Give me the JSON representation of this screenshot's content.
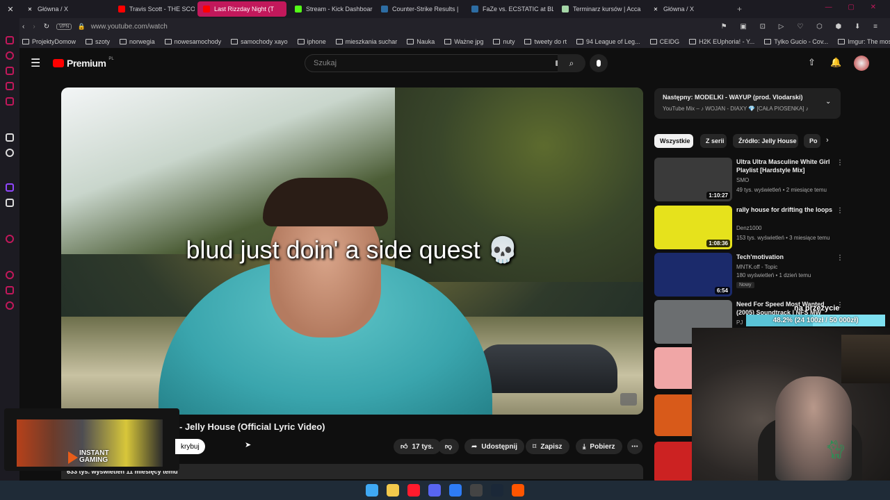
{
  "tabs": [
    {
      "label": "Główna / X",
      "icon": "x-logo-icon",
      "color": "#1c1b22"
    },
    {
      "label": "Travis Scott - THE SCOT",
      "icon": "youtube-icon",
      "color": "#ff0000"
    },
    {
      "label": "Last Rizzday Night (T",
      "icon": "youtube-icon",
      "color": "#ff0000",
      "active": true
    },
    {
      "label": "Stream - Kick Dashboard",
      "icon": "kick-icon",
      "color": "#53fc18"
    },
    {
      "label": "Counter-Strike Results | ",
      "icon": "hltv-icon",
      "color": "#2d6da3"
    },
    {
      "label": "FaZe vs. ECSTATIC at BL",
      "icon": "hltv-icon",
      "color": "#2d6da3"
    },
    {
      "label": "Terminarz kursów | Acca",
      "icon": "calendar-icon",
      "color": "#a5d6a7"
    },
    {
      "label": "Główna / X",
      "icon": "x-logo-icon",
      "color": "#1c1b22"
    }
  ],
  "address": {
    "vpn": "VPN",
    "url": "www.youtube.com/watch"
  },
  "bookmarks": [
    "ProjektyDomow",
    "szoty",
    "norwegia",
    "nowesamochody",
    "samochody xayo",
    "iphone",
    "mieszkania suchar",
    "Nauka",
    "Ważne jpg",
    "nuty",
    "tweety do rt",
    "94 League of Leg...",
    "CEIDG",
    "H2K EUphoria! - Y...",
    "Tylko Gucio - Cov...",
    "Imgur: The most a..."
  ],
  "yt": {
    "logo": "Premium",
    "logo_badge": "PL",
    "search_placeholder": "Szukaj",
    "caption": "blud just doin' a side quest 💀",
    "title": "- Jelly House (Official Lyric Video)",
    "hide_label": "krybuj",
    "likes": "17 tys.",
    "share": "Udostępnij",
    "save": "Zapisz",
    "download": "Pobierz",
    "views": "633 tys. wyświetleń  11 miesięcy temu",
    "ad_text_1": "INSTANT",
    "ad_text_2": "GAMING"
  },
  "next": {
    "title": "Następny: MODELKI - WAYUP (prod. Vlodarski)",
    "sub": "YouTube Mix – ♪ WOJAN - DIAXY 💎 [CAŁA PIOSENKA] ♪"
  },
  "chips": [
    "Wszystkie",
    "Z serii",
    "Źródło: Jelly House",
    "Po"
  ],
  "recs": [
    {
      "title": "Ultra Ultra Masculine White Girl Playlist [Hardstyle Mix]",
      "channel": "SMO",
      "meta": "49 tys. wyświetleń • 2 miesiące temu",
      "duration": "1:10:27",
      "thumb": "#3a3a3a"
    },
    {
      "title": "rally house for drifting the loops",
      "channel": "Denz1000",
      "meta": "153 tys. wyświetleń • 3 miesiące temu",
      "duration": "1:08:36",
      "thumb": "#e6e21c"
    },
    {
      "title": "Tech'motivation",
      "channel": "MNTK.off - Topic",
      "meta": "180 wyświetleń • 1 dzień temu",
      "duration": "6:54",
      "badge": "Nowy",
      "thumb": "#1b2a6b"
    },
    {
      "title": "Need For Speed Most Wanted (2005) Soundtrack | NFS MW",
      "channel": "PJ",
      "meta": "",
      "duration": "",
      "thumb": "#6b6e70"
    }
  ],
  "goal": {
    "label": "na przeżycie",
    "text": "48.2% (24 100zł / 50 000zł)",
    "progress": 0.482
  },
  "taskbar": [
    "windows-start-icon",
    "file-explorer-icon",
    "opera-gx-icon",
    "discord-icon",
    "messenger-icon",
    "obs-icon",
    "steam-icon",
    "faceit-icon"
  ]
}
